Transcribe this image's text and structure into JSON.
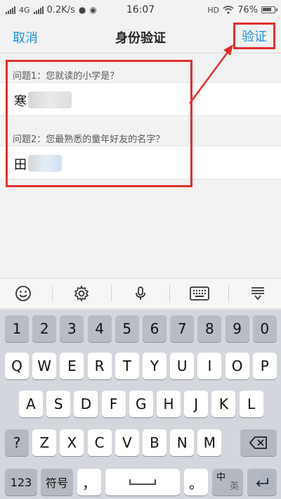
{
  "status_bar": {
    "network": "4G",
    "speed": "0.2K/s",
    "time": "16:07",
    "hd": "HD",
    "battery": "76%"
  },
  "nav": {
    "cancel": "取消",
    "title": "身份验证",
    "verify": "验证"
  },
  "questions": [
    {
      "label": "问题1：您就读的小学是？",
      "answer": "寒"
    },
    {
      "label": "问题2：您最熟悉的童年好友的名字？",
      "answer": "田"
    }
  ],
  "keyboard_toolbar": [
    "emoji-icon",
    "settings-icon",
    "microphone-icon",
    "keyboard-icon",
    "collapse-keyboard-icon"
  ],
  "keyboard": {
    "row_digits": [
      "1",
      "2",
      "3",
      "4",
      "5",
      "6",
      "7",
      "8",
      "9",
      "0"
    ],
    "row1": [
      "Q",
      "W",
      "E",
      "R",
      "T",
      "Y",
      "U",
      "I",
      "O",
      "P"
    ],
    "row2": [
      "A",
      "S",
      "D",
      "F",
      "G",
      "H",
      "J",
      "K",
      "L"
    ],
    "row3": [
      "?",
      "Z",
      "X",
      "C",
      "V",
      "B",
      "N",
      "M"
    ],
    "num_key": "123",
    "symbol_key": "符号",
    "comma_key": "，",
    "period_key": "。",
    "lang_top": "中",
    "lang_bottom": "英"
  },
  "colors": {
    "accent": "#1e8fdc",
    "highlight": "#e0312f"
  }
}
